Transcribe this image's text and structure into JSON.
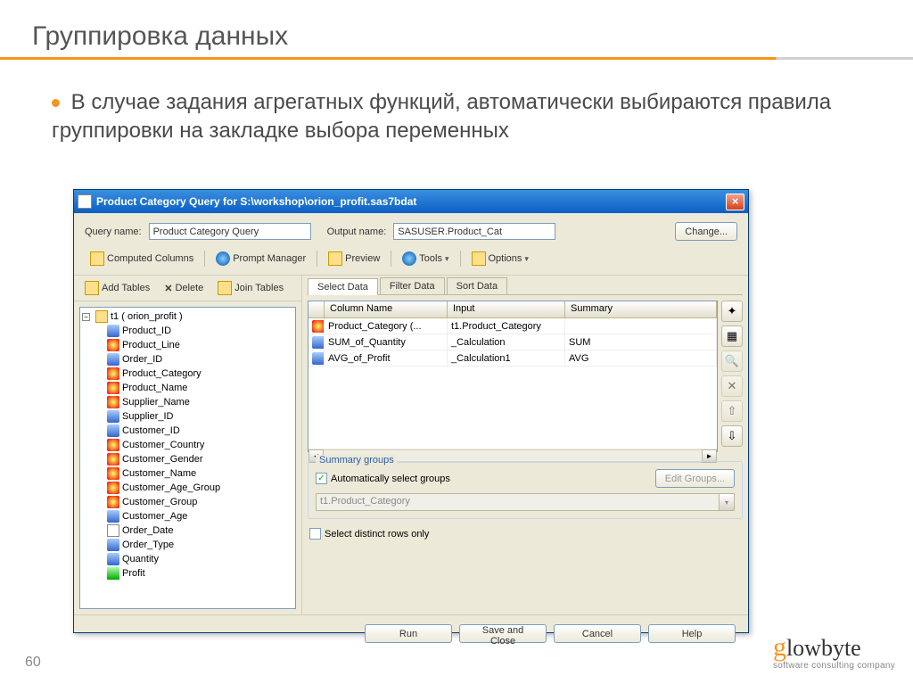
{
  "slide": {
    "title": "Группировка данных",
    "bullet": "В случае задания агрегатных функций, автоматически выбираются правила группировки на закладке выбора переменных",
    "page_number": "60",
    "logo_text": "glowbyte",
    "logo_sub": "software consulting company"
  },
  "dialog": {
    "title": "Product Category Query for S:\\workshop\\orion_profit.sas7bdat",
    "query_name_label": "Query name:",
    "query_name_value": "Product Category Query",
    "output_name_label": "Output name:",
    "output_name_value": "SASUSER.Product_Cat",
    "change_btn": "Change...",
    "toolbar": {
      "computed_columns": "Computed Columns",
      "prompt_manager": "Prompt Manager",
      "preview": "Preview",
      "tools": "Tools",
      "options": "Options"
    },
    "left_toolbar": {
      "add_tables": "Add Tables",
      "delete": "Delete",
      "join_tables": "Join Tables"
    },
    "tree_root": "t1 ( orion_profit )",
    "tree_items": [
      {
        "label": "Product_ID",
        "icon": "num"
      },
      {
        "label": "Product_Line",
        "icon": "red"
      },
      {
        "label": "Order_ID",
        "icon": "num"
      },
      {
        "label": "Product_Category",
        "icon": "red"
      },
      {
        "label": "Product_Name",
        "icon": "red"
      },
      {
        "label": "Supplier_Name",
        "icon": "red"
      },
      {
        "label": "Supplier_ID",
        "icon": "num"
      },
      {
        "label": "Customer_ID",
        "icon": "num"
      },
      {
        "label": "Customer_Country",
        "icon": "red"
      },
      {
        "label": "Customer_Gender",
        "icon": "red"
      },
      {
        "label": "Customer_Name",
        "icon": "red"
      },
      {
        "label": "Customer_Age_Group",
        "icon": "red"
      },
      {
        "label": "Customer_Group",
        "icon": "red"
      },
      {
        "label": "Customer_Age",
        "icon": "num"
      },
      {
        "label": "Order_Date",
        "icon": "cal"
      },
      {
        "label": "Order_Type",
        "icon": "num"
      },
      {
        "label": "Quantity",
        "icon": "num"
      },
      {
        "label": "Profit",
        "icon": "green"
      }
    ],
    "tabs": {
      "select_data": "Select Data",
      "filter_data": "Filter Data",
      "sort_data": "Sort Data"
    },
    "grid_headers": {
      "col1": "Column Name",
      "col2": "Input",
      "col3": "Summary"
    },
    "grid_rows": [
      {
        "name": "Product_Category (...",
        "input": "t1.Product_Category",
        "summary": "",
        "icon": "red"
      },
      {
        "name": "SUM_of_Quantity",
        "input": "_Calculation",
        "summary": "SUM",
        "icon": "sigma"
      },
      {
        "name": "AVG_of_Profit",
        "input": "_Calculation1",
        "summary": "AVG",
        "icon": "sigma"
      }
    ],
    "summary_groups": {
      "title": "Summary groups",
      "auto_check": "Automatically select groups",
      "edit_groups": "Edit Groups...",
      "combo_value": "t1.Product_Category"
    },
    "distinct": "Select distinct rows only",
    "buttons": {
      "run": "Run",
      "save": "Save and Close",
      "cancel": "Cancel",
      "help": "Help"
    }
  }
}
